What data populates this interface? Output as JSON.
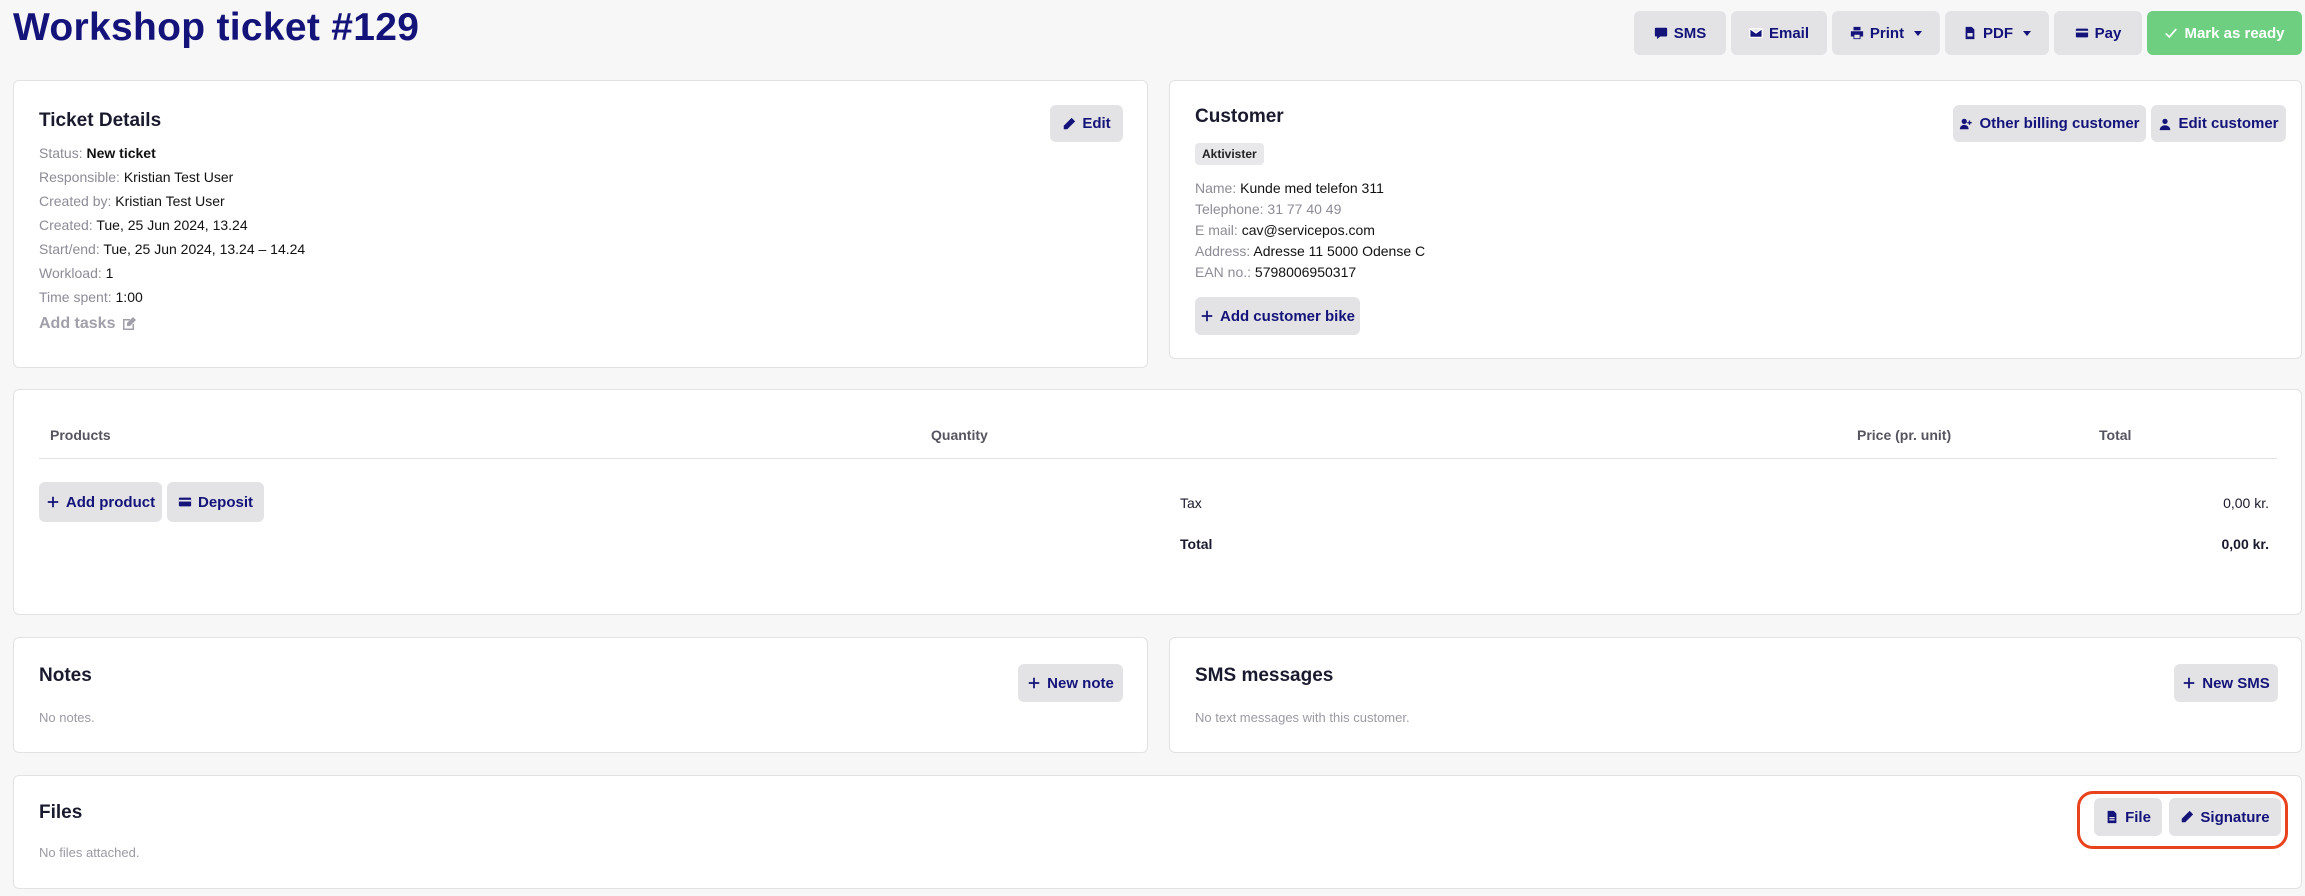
{
  "page": {
    "title": "Workshop ticket #129"
  },
  "toolbar": {
    "sms": "SMS",
    "email": "Email",
    "print": "Print",
    "pdf": "PDF",
    "pay": "Pay",
    "mark_ready": "Mark as ready"
  },
  "ticket_details": {
    "title": "Ticket Details",
    "edit": "Edit",
    "fields": [
      {
        "label": "Status:",
        "value": "New ticket",
        "bold": true
      },
      {
        "label": "Responsible:",
        "value": "Kristian Test User"
      },
      {
        "label": "Created by:",
        "value": "Kristian Test User"
      },
      {
        "label": "Created:",
        "value": "Tue, 25 Jun 2024, 13.24"
      },
      {
        "label": "Start/end:",
        "value": "Tue, 25 Jun 2024, 13.24 – 14.24"
      },
      {
        "label": "Workload:",
        "value": "1"
      },
      {
        "label": "Time spent:",
        "value": "1:00"
      }
    ],
    "add_tasks": "Add tasks"
  },
  "customer": {
    "title": "Customer",
    "badge": "Aktivister",
    "other_billing": "Other billing customer",
    "edit_customer": "Edit customer",
    "fields": [
      {
        "label": "Name:",
        "value": "Kunde med telefon 311"
      },
      {
        "label": "Telephone:",
        "value": "31 77 40 49",
        "muted": true
      },
      {
        "label": "E mail:",
        "value": "cav@servicepos.com"
      },
      {
        "label": "Address:",
        "value": "Adresse 11 5000 Odense C"
      },
      {
        "label": "EAN no.:",
        "value": "5798006950317"
      }
    ],
    "add_bike": "Add customer bike"
  },
  "products": {
    "headers": {
      "products": "Products",
      "quantity": "Quantity",
      "price": "Price (pr. unit)",
      "total": "Total"
    },
    "add_product": "Add product",
    "deposit": "Deposit",
    "tax_label": "Tax",
    "tax_value": "0,00 kr.",
    "total_label": "Total",
    "total_value": "0,00 kr."
  },
  "notes": {
    "title": "Notes",
    "new_note": "New note",
    "empty": "No notes."
  },
  "sms": {
    "title": "SMS messages",
    "new_sms": "New SMS",
    "empty": "No text messages with this customer."
  },
  "files": {
    "title": "Files",
    "file": "File",
    "signature": "Signature",
    "empty": "No files attached."
  },
  "colors": {
    "title": "#13137a",
    "ready": "#6fcf80",
    "highlight": "#e8431c"
  }
}
